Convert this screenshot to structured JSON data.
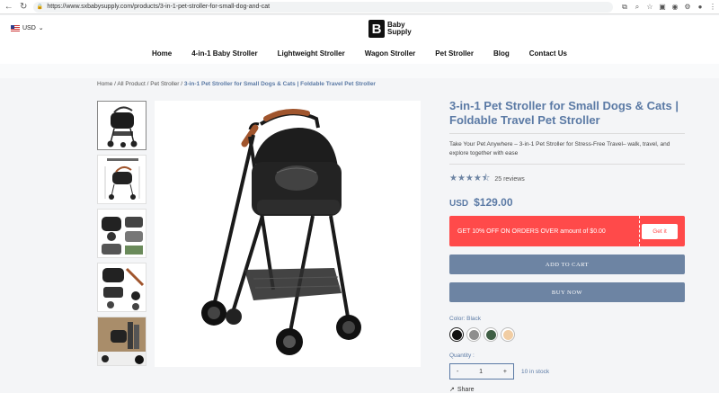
{
  "browser": {
    "url": "https://www.sxbabysupply.com/products/3-in-1-pet-stroller-for-small-dog-and-cat",
    "back_icon": "arrow-left-icon",
    "reload_icon": "reload-icon"
  },
  "store": {
    "currency": "USD",
    "logo_line1": "Baby",
    "logo_line2": "Supply",
    "logo_mark": "B"
  },
  "nav": {
    "items": [
      "Home",
      "4-in-1 Baby Stroller",
      "Lightweight Stroller",
      "Wagon Stroller",
      "Pet Stroller",
      "Blog",
      "Contact Us"
    ]
  },
  "breadcrumb": {
    "home": "Home",
    "all": "All Product",
    "category": "Pet Stroller",
    "current": "3-in-1 Pet Stroller for Small Dogs & Cats | Foldable Travel Pet Stroller",
    "sep": " / "
  },
  "product": {
    "title": "3-in-1 Pet Stroller for Small Dogs & Cats | Foldable Travel Pet Stroller",
    "description": "Take Your Pet Anywhere – 3-in-1 Pet Stroller for Stress-Free Travel– walk, travel, and explore together with ease",
    "rating": 4.5,
    "stars": "★★★★⯪",
    "reviews": "25 reviews",
    "currency": "USD",
    "price": "$129.00",
    "promo_text": "GET 10% OFF ON ORDERS OVER amount of $0.00",
    "promo_button": "Get it",
    "add_to_cart": "ADD TO CART",
    "buy_now": "BUY NOW",
    "color_label": "Color: Black",
    "colors": [
      "#111111",
      "#8e8e8e",
      "#3f5f45",
      "#f1cda3"
    ],
    "quantity_label": "Quantity :",
    "quantity": "1",
    "minus": "-",
    "plus": "+",
    "stock": "10 in stock",
    "share": "Share"
  },
  "colors": {
    "accent": "#5b7aa5",
    "button": "#6d84a3",
    "promo": "#ff4a4a"
  }
}
